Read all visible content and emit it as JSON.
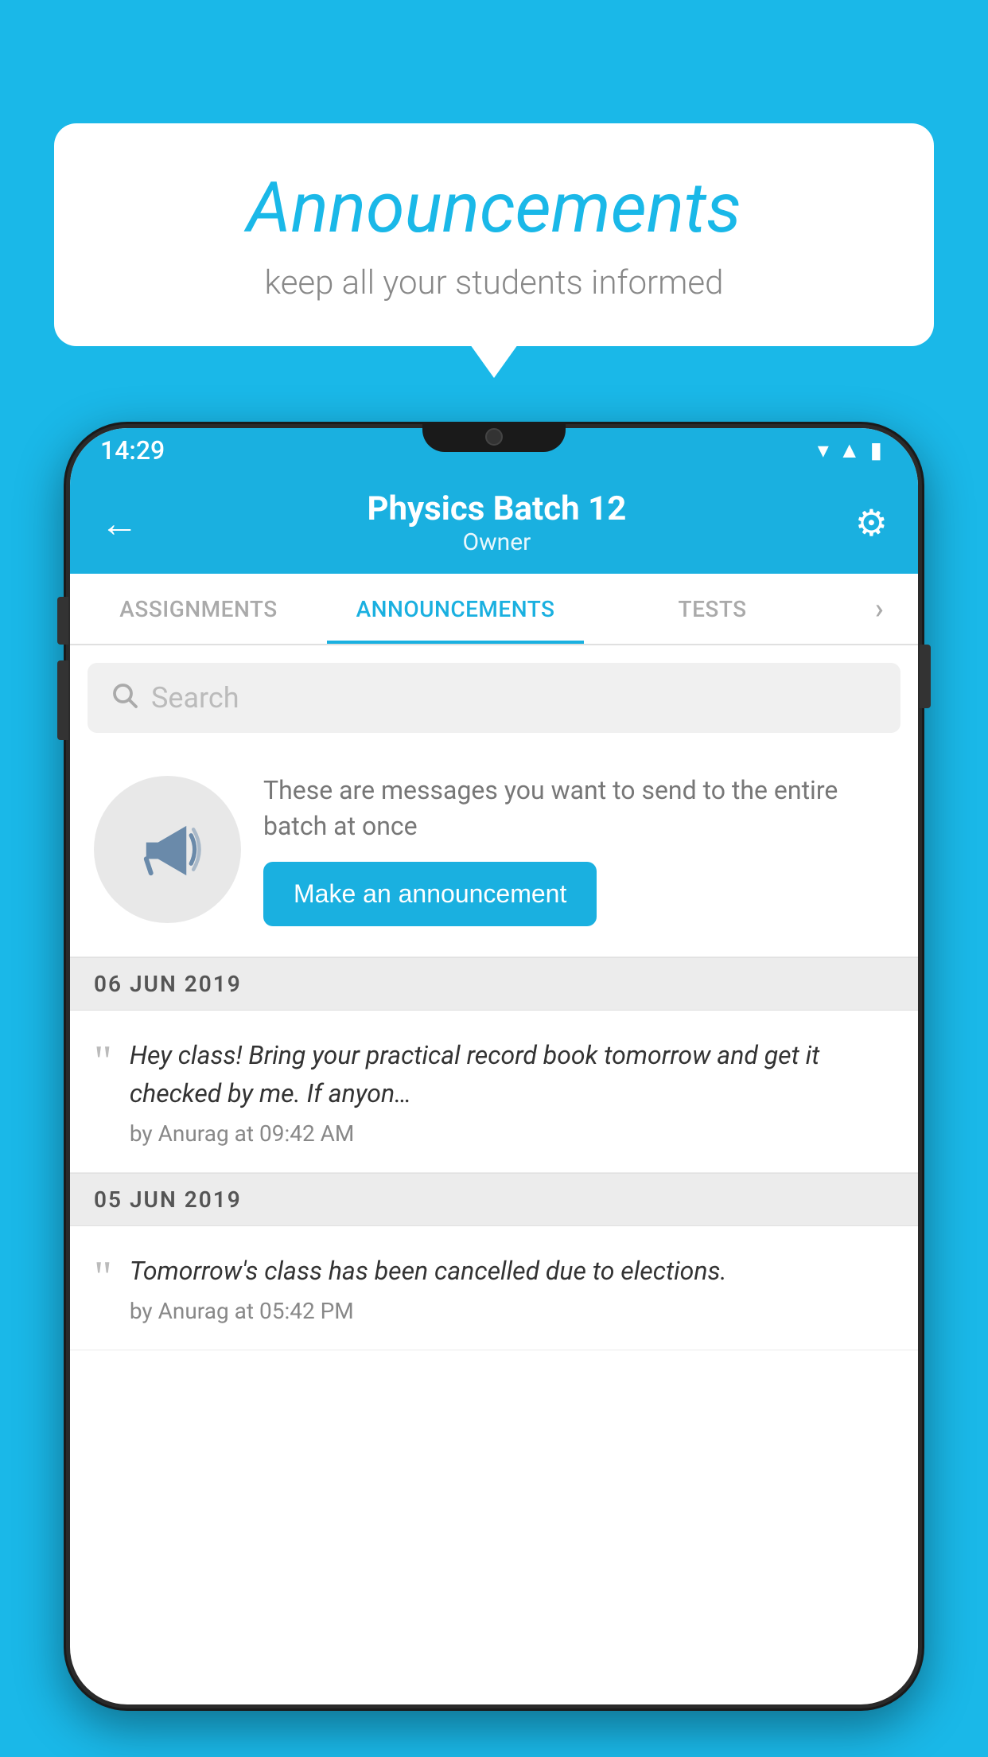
{
  "bubble": {
    "title": "Announcements",
    "subtitle": "keep all your students informed"
  },
  "status_bar": {
    "time": "14:29",
    "wifi": "▾",
    "signal": "▲",
    "battery": "▮"
  },
  "header": {
    "title": "Physics Batch 12",
    "subtitle": "Owner",
    "back_label": "←",
    "gear_label": "⚙"
  },
  "tabs": [
    {
      "label": "ASSIGNMENTS",
      "active": false
    },
    {
      "label": "ANNOUNCEMENTS",
      "active": true
    },
    {
      "label": "TESTS",
      "active": false
    },
    {
      "label": "›",
      "active": false
    }
  ],
  "search": {
    "placeholder": "Search"
  },
  "promo": {
    "text": "These are messages you want to send to the entire batch at once",
    "button_label": "Make an announcement"
  },
  "announcements": [
    {
      "date": "06  JUN  2019",
      "text": "Hey class! Bring your practical record book tomorrow and get it checked by me. If anyon…",
      "meta": "by Anurag at 09:42 AM"
    },
    {
      "date": "05  JUN  2019",
      "text": "Tomorrow's class has been cancelled due to elections.",
      "meta": "by Anurag at 05:42 PM"
    }
  ]
}
